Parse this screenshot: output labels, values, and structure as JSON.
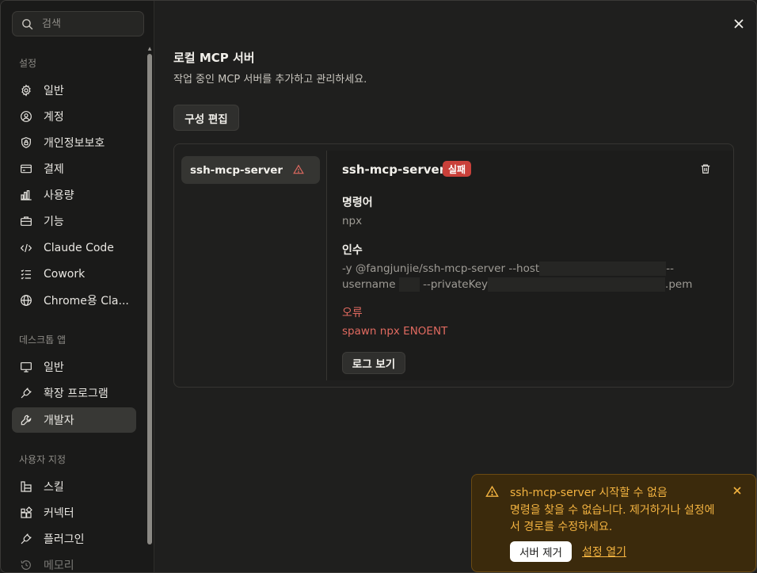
{
  "sidebar": {
    "search_placeholder": "검색",
    "sections": {
      "settings": "설정",
      "desktop": "데스크톱 앱",
      "custom": "사용자 지정"
    },
    "settings_items": [
      {
        "label": "일반",
        "icon": "gear-icon"
      },
      {
        "label": "계정",
        "icon": "user-circle-icon"
      },
      {
        "label": "개인정보보호",
        "icon": "shield-lock-icon"
      },
      {
        "label": "결제",
        "icon": "card-icon"
      },
      {
        "label": "사용량",
        "icon": "bar-chart-icon"
      },
      {
        "label": "기능",
        "icon": "briefcase-icon"
      },
      {
        "label": "Claude Code",
        "icon": "code-icon"
      },
      {
        "label": "Cowork",
        "icon": "checklist-icon"
      },
      {
        "label": "Chrome용 Cla...",
        "icon": "globe-icon"
      }
    ],
    "desktop_items": [
      {
        "label": "일반",
        "icon": "monitor-icon"
      },
      {
        "label": "확장 프로그램",
        "icon": "plug-icon"
      },
      {
        "label": "개발자",
        "icon": "wrench-icon"
      }
    ],
    "custom_items": [
      {
        "label": "스킬",
        "icon": "skill-icon"
      },
      {
        "label": "커넥터",
        "icon": "connector-icon"
      },
      {
        "label": "플러그인",
        "icon": "plug-icon"
      },
      {
        "label": "메모리",
        "icon": "history-icon"
      }
    ]
  },
  "main": {
    "title": "로컬 MCP 서버",
    "subtitle": "작업 중인 MCP 서버를 추가하고 관리하세요.",
    "edit_config_label": "구성 편집",
    "server_list": [
      {
        "name": "ssh-mcp-server"
      }
    ],
    "detail": {
      "name": "ssh-mcp-server",
      "status": "실패",
      "command_label": "명령어",
      "command_value": "npx",
      "args_label": "인수",
      "args_line1_a": "-y @fangjunjie/ssh-mcp-server --host",
      "args_line1_b": "--",
      "args_line2_a": "username",
      "args_line2_b": "--privateKey",
      "args_line2_c": ".pem",
      "error_label": "오류",
      "error_value": "spawn npx ENOENT",
      "view_logs_label": "로그 보기"
    }
  },
  "toast": {
    "title": "ssh-mcp-server 시작할 수 없음",
    "message": "명령을 찾을 수 없습니다. 제거하거나 설정에서 경로를 수정하세요.",
    "remove_label": "서버 제거",
    "open_settings_label": "설정 열기"
  },
  "colors": {
    "accent_warning": "#f3b340",
    "error": "#e06a60",
    "badge_fail": "#c9403a"
  }
}
